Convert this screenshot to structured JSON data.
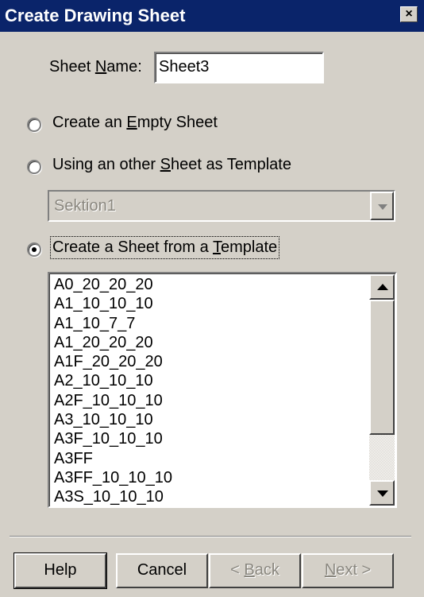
{
  "dialog": {
    "title": "Create Drawing Sheet",
    "close_symbol": "×"
  },
  "sheet_name": {
    "label_pre": "Sheet ",
    "label_key": "N",
    "label_post": "ame:",
    "value": "Sheet3"
  },
  "options": [
    {
      "pre": "Create an ",
      "key": "E",
      "post": "mpty Sheet",
      "selected": false
    },
    {
      "pre": "Using an other ",
      "key": "S",
      "post": "heet as Template",
      "selected": false
    },
    {
      "pre": "Create a Sheet from a ",
      "key": "T",
      "post": "emplate",
      "selected": true
    }
  ],
  "template_combo": {
    "value": "Sektion1",
    "enabled": false
  },
  "template_list": {
    "items": [
      "A0_20_20_20",
      "A1_10_10_10",
      "A1_10_7_7",
      "A1_20_20_20",
      "A1F_20_20_20",
      "A2_10_10_10",
      "A2F_10_10_10",
      "A3_10_10_10",
      "A3F_10_10_10",
      "A3FF",
      "A3FF_10_10_10",
      "A3S_10_10_10"
    ]
  },
  "buttons": {
    "help": "Help",
    "cancel": "Cancel",
    "back_key": "B",
    "back_pre": "< ",
    "back_post": "ack",
    "next_key": "N",
    "next_post": "ext >"
  },
  "colors": {
    "face": "#d4d0c8",
    "title_bar": "#0a246a",
    "disabled_text": "#8a877f"
  }
}
